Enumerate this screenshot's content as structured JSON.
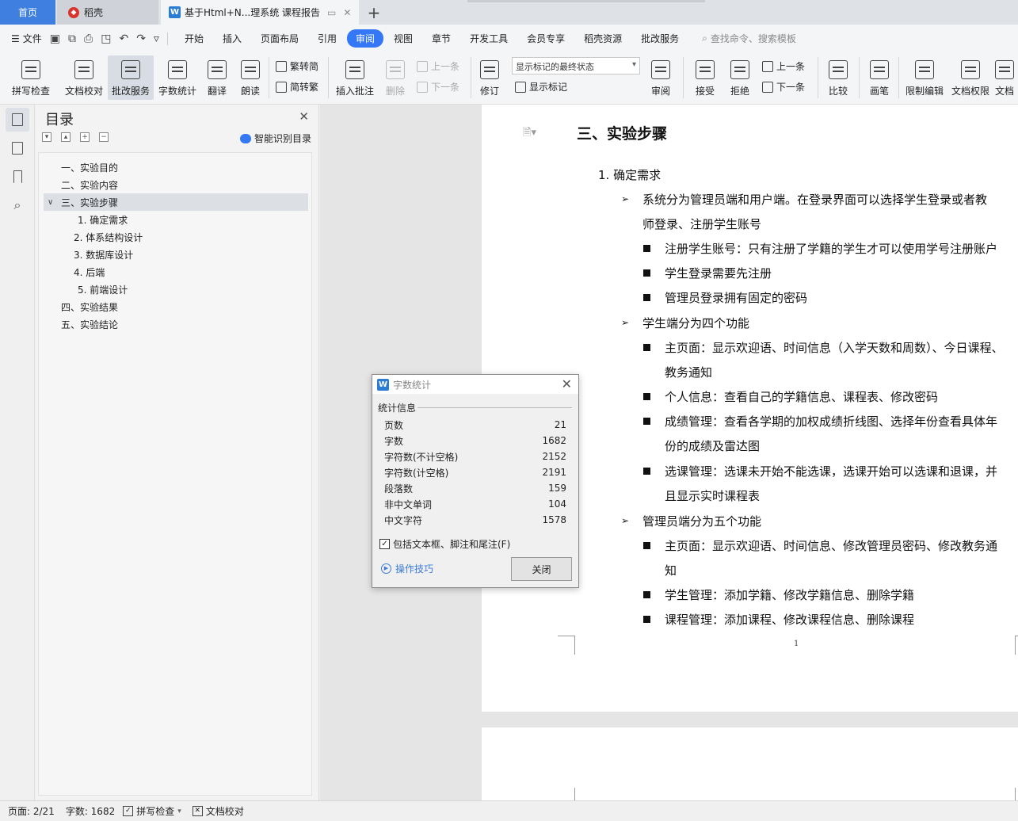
{
  "tabs": {
    "home": "首页",
    "daoke": "稻壳",
    "doc": "基于Html+N...理系统 课程报告"
  },
  "menu": {
    "file": "文件",
    "tabs": [
      "开始",
      "插入",
      "页面布局",
      "引用",
      "审阅",
      "视图",
      "章节",
      "开发工具",
      "会员专享",
      "稻壳资源",
      "批改服务"
    ],
    "active": "审阅",
    "search": "查找命令、搜索模板"
  },
  "ribbon": {
    "spellcheck": "拼写检查",
    "doc_check": "文档校对",
    "review_service": "批改服务",
    "word_count": "字数统计",
    "translate": "翻译",
    "read_aloud": "朗读",
    "trad_to_simp": "繁转简",
    "simp_to_trad": "简转繁",
    "insert_comment": "插入批注",
    "delete": "删除",
    "prev": "上一条",
    "next": "下一条",
    "track": "修订",
    "markup_state": "显示标记的最终状态",
    "show_markup": "显示标记",
    "review": "审阅",
    "accept": "接受",
    "reject": "拒绝",
    "prev2": "上一条",
    "next2": "下一条",
    "compare": "比较",
    "pen": "画笔",
    "restrict": "限制编辑",
    "rights": "文档权限",
    "doc_more": "文档"
  },
  "toc": {
    "title": "目录",
    "smart": "智能识别目录",
    "items": [
      "一、实验目的",
      "二、实验内容",
      "三、实验步骤",
      "1. 确定需求",
      "2. 体系结构设计",
      "3. 数据库设计",
      "4. 后端",
      "5. 前端设计",
      "四、实验结果",
      "五、实验结论"
    ]
  },
  "document": {
    "heading": "三、实验步骤",
    "lines": [
      "1. 确定需求",
      "系统分为管理员端和用户端。在登录界面可以选择学生登录或者教",
      "师登录、注册学生账号",
      "注册学生账号：只有注册了学籍的学生才可以使用学号注册账户",
      "学生登录需要先注册",
      "管理员登录拥有固定的密码",
      "学生端分为四个功能",
      "主页面：显示欢迎语、时间信息（入学天数和周数）、今日课程、",
      "教务通知",
      "个人信息：查看自己的学籍信息、课程表、修改密码",
      "成绩管理：查看各学期的加权成绩折线图、选择年份查看具体年",
      "份的成绩及雷达图",
      "选课管理：选课未开始不能选课，选课开始可以选课和退课，并",
      "且显示实时课程表",
      "管理员端分为五个功能",
      "主页面：显示欢迎语、时间信息、修改管理员密码、修改教务通",
      "知",
      "学生管理：添加学籍、修改学籍信息、删除学籍",
      "课程管理：添加课程、修改课程信息、删除课程"
    ],
    "page_number": "1"
  },
  "dialog": {
    "title": "字数统计",
    "section": "统计信息",
    "rows": [
      {
        "label": "页数",
        "value": "21"
      },
      {
        "label": "字数",
        "value": "1682"
      },
      {
        "label": "字符数(不计空格)",
        "value": "2152"
      },
      {
        "label": "字符数(计空格)",
        "value": "2191"
      },
      {
        "label": "段落数",
        "value": "159"
      },
      {
        "label": "非中文单词",
        "value": "104"
      },
      {
        "label": "中文字符",
        "value": "1578"
      }
    ],
    "include_label": "包括文本框、脚注和尾注(F)",
    "tips": "操作技巧",
    "close": "关闭"
  },
  "status": {
    "page": "页面: 2/21",
    "words": "字数: 1682",
    "spellcheck": "拼写检查",
    "doc_check": "文档校对"
  }
}
